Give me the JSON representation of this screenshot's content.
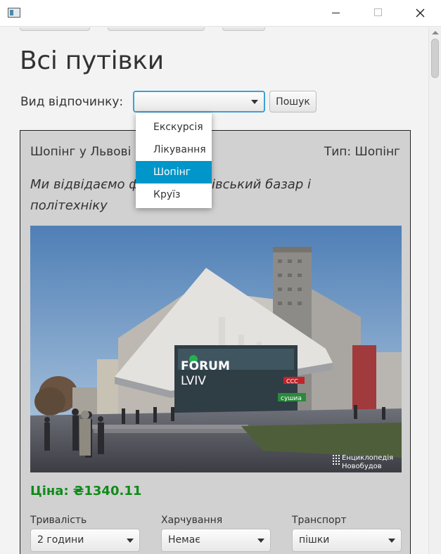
{
  "window": {
    "icon": "app-window-icon",
    "controls": [
      "minimize-icon",
      "maximize-icon",
      "close-icon"
    ]
  },
  "page": {
    "title": "Всі путівки"
  },
  "filter": {
    "label": "Вид відпочинку:",
    "selected": "",
    "options": [
      "Екскурсія",
      "Лікування",
      "Шопінг",
      "Круїз"
    ],
    "highlighted_index": 2,
    "search_label": "Пошук",
    "accent_color": "#0096c9"
  },
  "tour": {
    "name": "Шопінг у Львові",
    "type": "Тип: Шопінг",
    "description": "Ми відвідаємо форум, краківський базар і політехніку",
    "photo": {
      "signage": "FORUM LVIV",
      "watermark": "Енциклопедія Новобудов",
      "shop_sign": "сушиа",
      "store_logo": "CCC"
    },
    "price": "Ціна: ₴1340.11",
    "price_color": "#108a1a",
    "fields": [
      {
        "label": "Тривалість",
        "value": "2 години"
      },
      {
        "label": "Харчування",
        "value": "Немає"
      },
      {
        "label": "Транспорт",
        "value": "пішки"
      }
    ]
  }
}
